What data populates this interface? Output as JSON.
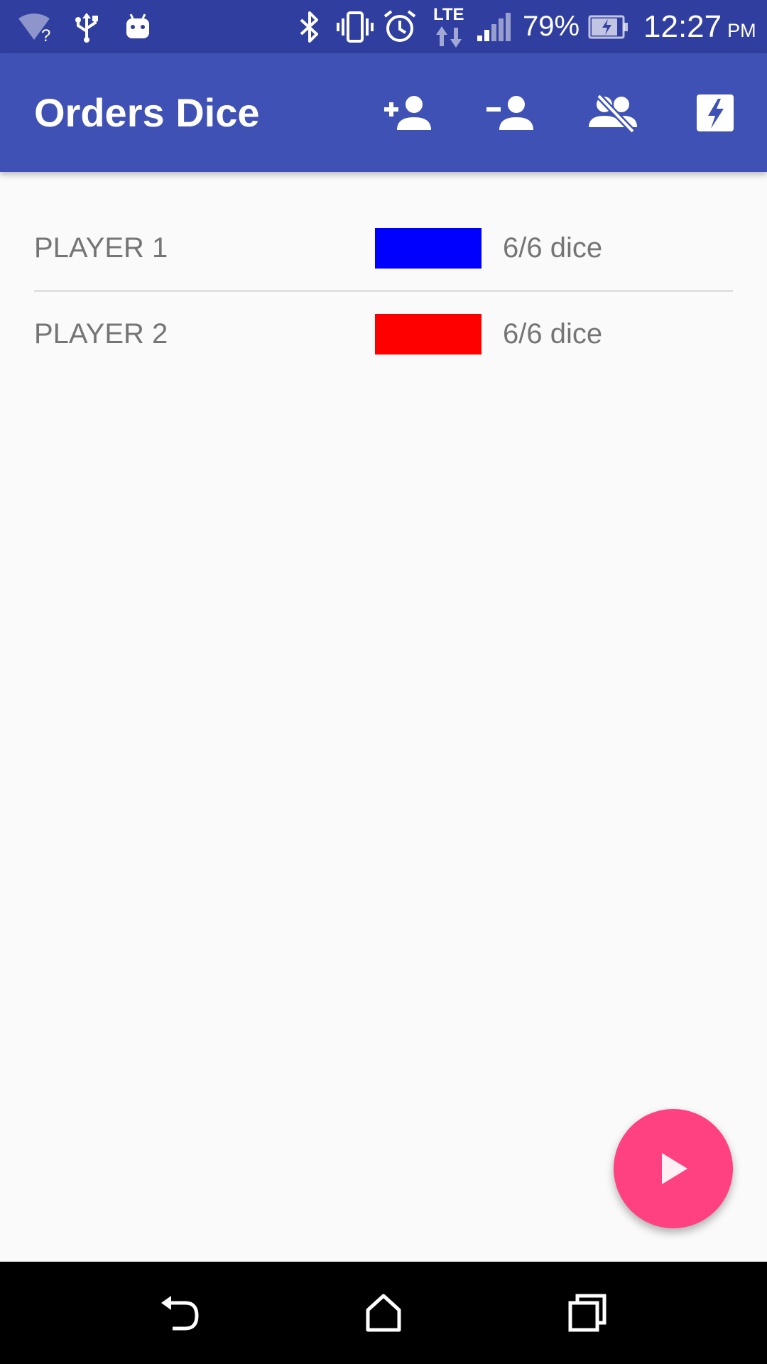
{
  "status_bar": {
    "icons": [
      "wifi-unknown-icon",
      "usb-icon",
      "android-icon",
      "bluetooth-icon",
      "vibrate-icon",
      "alarm-icon",
      "lte-data-icon",
      "cell-signal-icon",
      "battery-charging-icon"
    ],
    "lte_label": "LTE",
    "battery_percent": "79%",
    "time": "12:27",
    "ampm": "PM",
    "background_color": "#303f9f"
  },
  "app_bar": {
    "title": "Orders Dice",
    "background_color": "#3f51b5",
    "actions": [
      {
        "icon": "add-person-icon"
      },
      {
        "icon": "remove-person-icon"
      },
      {
        "icon": "remove-all-people-icon"
      },
      {
        "icon": "flash-card-icon"
      }
    ]
  },
  "players": [
    {
      "name": "PLAYER 1",
      "color": "#0000ff",
      "dice": "6/6 dice"
    },
    {
      "name": "PLAYER 2",
      "color": "#ff0000",
      "dice": "6/6 dice"
    }
  ],
  "fab": {
    "icon": "play-icon",
    "color": "#ff4081"
  },
  "nav_bar": {
    "buttons": [
      "back-icon",
      "home-icon",
      "recents-icon"
    ]
  }
}
